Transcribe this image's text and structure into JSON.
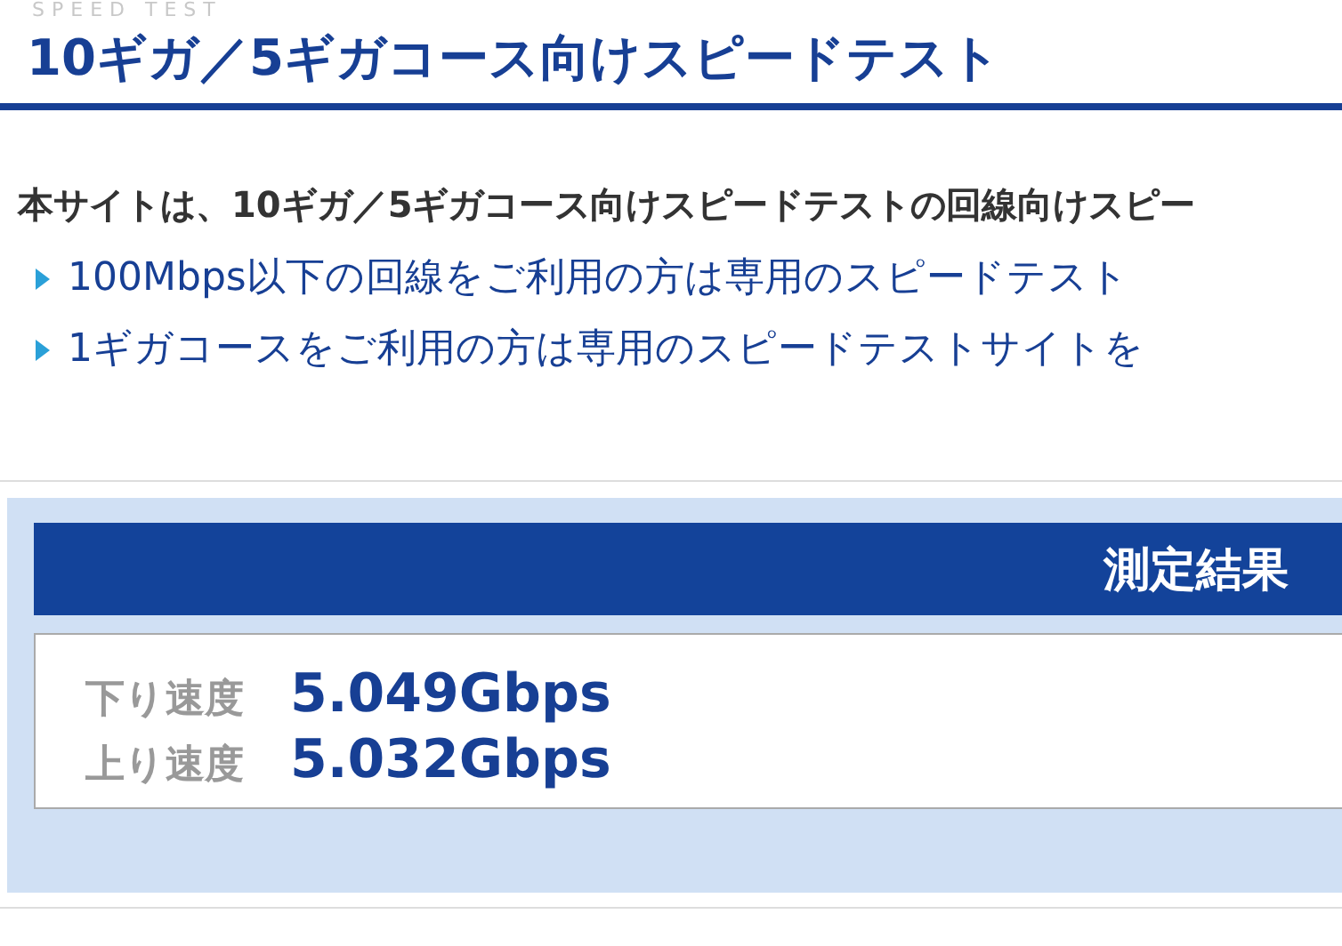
{
  "page": {
    "kicker": "SPEED TEST",
    "title": "10ギガ／5ギガコース向けスピードテスト"
  },
  "intro": "本サイトは、10ギガ／5ギガコース向けスピードテストの回線向けスピー",
  "links": [
    {
      "text": "100Mbps以下の回線をご利用の方は専用のスピードテスト"
    },
    {
      "text": "1ギガコースをご利用の方は専用のスピードテストサイトを"
    }
  ],
  "result": {
    "heading": "測定結果",
    "rows": [
      {
        "label": "下り速度",
        "value": "5.049Gbps"
      },
      {
        "label": "上り速度",
        "value": "5.032Gbps"
      }
    ]
  }
}
